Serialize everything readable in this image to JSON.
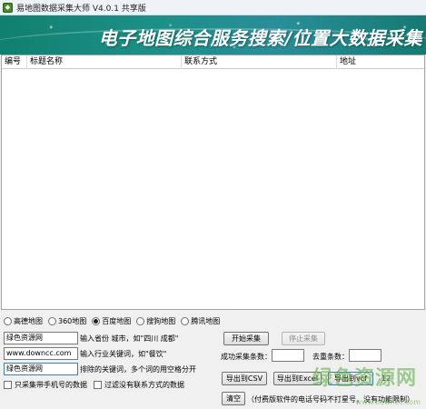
{
  "window": {
    "title": "易地图数据采集大师 V4.0.1 共享版"
  },
  "banner": {
    "text": "电子地图综合服务搜索/位置大数据采集"
  },
  "table": {
    "columns": [
      "编号",
      "标题名称",
      "联系方式",
      "地址"
    ],
    "rows": []
  },
  "map_sources": {
    "options": [
      "高德地图",
      "360地图",
      "百度地图",
      "搜狗地图",
      "腾讯地图"
    ],
    "selected": "百度地图"
  },
  "form": {
    "city_value": "绿色资源网",
    "city_hint": "输入省份 城市，如\"四川 成都\"",
    "keyword_value": "www.downcc.com",
    "keyword_hint": "输入行业关键词，如\"餐饮\"",
    "exclude_value": "绿色资源网",
    "exclude_hint": "排除的关键词，多个词的用空格分开",
    "mobile_only_label": "只采集带手机号的数据",
    "filter_no_contact_label": "过滤没有联系方式的数据"
  },
  "actions": {
    "start": "开始采集",
    "stop": "停止采集",
    "success_label": "成功采集条数：",
    "duplicate_label": "去重条数：",
    "export_csv": "导出到CSV",
    "export_excel": "导出到Excel",
    "export_vcf": "导出到vcf",
    "clear": "清空",
    "trial_note": "（付费版软件的电话号码不打星号，没有功能限制）",
    "version_fragment": "12"
  },
  "watermark": {
    "text": "绿色资源网",
    "url": "www.downcc.com"
  },
  "colors": {
    "banner": "#1c8f86",
    "window_bg": "#f0f0f0",
    "watermark": "#5aaa3c"
  }
}
